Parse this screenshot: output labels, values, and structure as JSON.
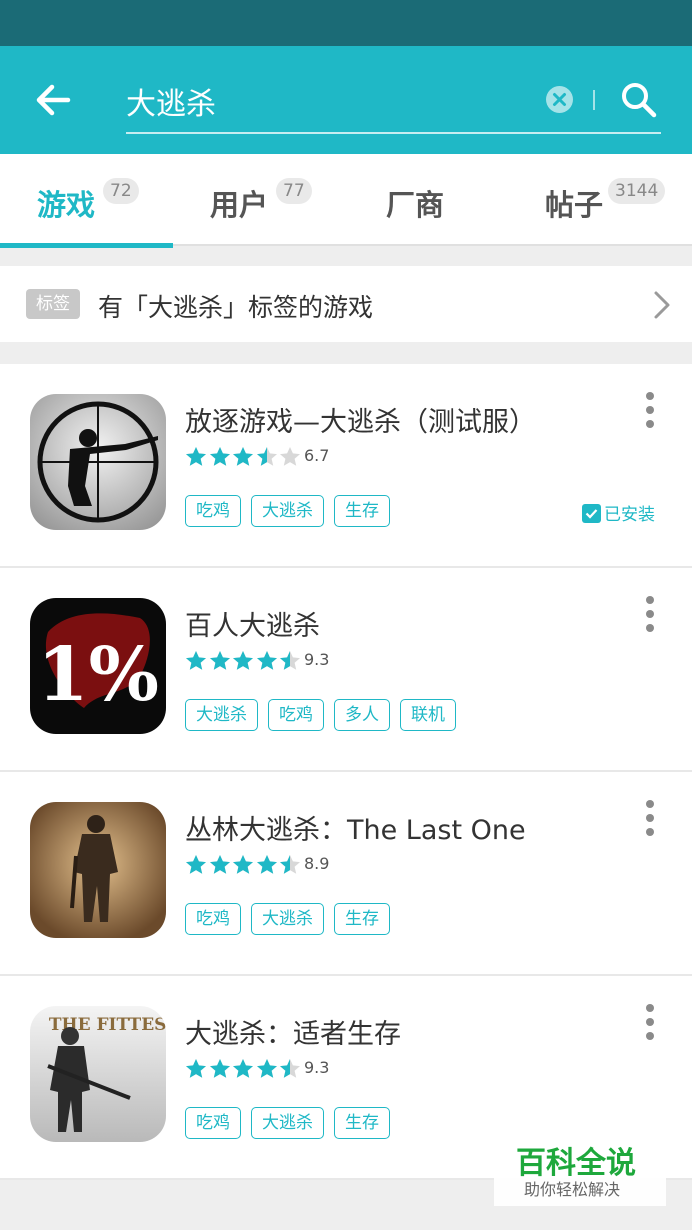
{
  "colors": {
    "accent": "#1fb8c6",
    "status_bar": "#1b6b76",
    "star": "#1fb8c6",
    "star_empty": "#d8d8d8",
    "watermark": "#1ea83c"
  },
  "search": {
    "value": "大逃杀",
    "back_icon": "arrow-left-icon",
    "clear_icon": "clear-circle-icon",
    "search_icon": "magnifier-icon"
  },
  "tabs": [
    {
      "label": "游戏",
      "count": "72",
      "active": true
    },
    {
      "label": "用户",
      "count": "77",
      "active": false
    },
    {
      "label": "厂商",
      "count": "",
      "active": false
    },
    {
      "label": "帖子",
      "count": "3144",
      "active": false
    }
  ],
  "tag_banner": {
    "chip": "标签",
    "text": "有「大逃杀」标签的游戏"
  },
  "games": [
    {
      "title": "放逐游戏—大逃杀（测试服）",
      "rating": "6.7",
      "stars": 3.5,
      "tags": [
        "吃鸡",
        "大逃杀",
        "生存"
      ],
      "installed": "已安装"
    },
    {
      "title": "百人大逃杀",
      "rating": "9.3",
      "stars": 4.5,
      "tags": [
        "大逃杀",
        "吃鸡",
        "多人",
        "联机"
      ]
    },
    {
      "title": "丛林大逃杀：The Last One",
      "rating": "8.9",
      "stars": 4.5,
      "tags": [
        "吃鸡",
        "大逃杀",
        "生存"
      ]
    },
    {
      "title": "大逃杀：适者生存",
      "rating": "9.3",
      "stars": 4.5,
      "tags": [
        "吃鸡",
        "大逃杀",
        "生存"
      ]
    }
  ],
  "icon_logo": {
    "game2_text": "1%",
    "game4_text": "THE FITTEST"
  },
  "watermark": {
    "title": "百科全说",
    "subtitle": "助你轻松解决"
  }
}
